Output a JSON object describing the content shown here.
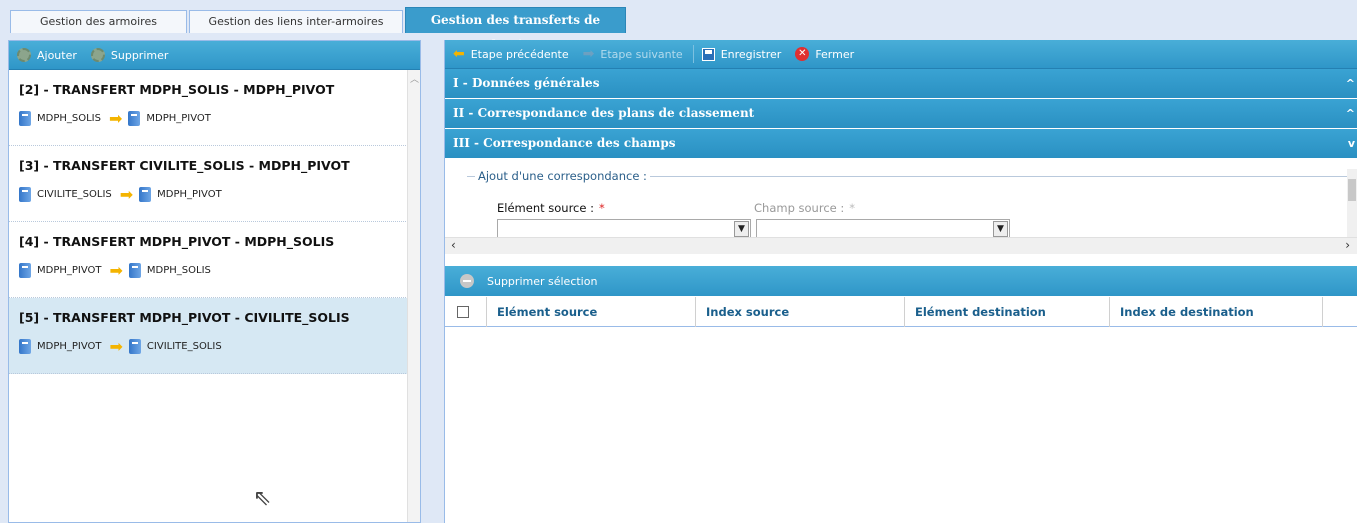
{
  "tabs": [
    {
      "label": "Gestion des armoires"
    },
    {
      "label": "Gestion des liens inter-armoires"
    },
    {
      "label": "Gestion des transferts de dossiers",
      "active": true
    }
  ],
  "left_toolbar": {
    "add_label": "Ajouter",
    "delete_label": "Supprimer"
  },
  "transfers": [
    {
      "title": "[2] - TRANSFERT MDPH_SOLIS - MDPH_PIVOT",
      "source": "MDPH_SOLIS",
      "target": "MDPH_PIVOT"
    },
    {
      "title": "[3] - TRANSFERT CIVILITE_SOLIS - MDPH_PIVOT",
      "source": "CIVILITE_SOLIS",
      "target": "MDPH_PIVOT"
    },
    {
      "title": "[4] - TRANSFERT MDPH_PIVOT - MDPH_SOLIS",
      "source": "MDPH_PIVOT",
      "target": "MDPH_SOLIS"
    },
    {
      "title": "[5] - TRANSFERT MDPH_PIVOT - CIVILITE_SOLIS",
      "source": "MDPH_PIVOT",
      "target": "CIVILITE_SOLIS",
      "selected": true
    }
  ],
  "right_toolbar": {
    "prev_label": "Etape précédente",
    "next_label": "Etape suivante",
    "save_label": "Enregistrer",
    "close_label": "Fermer"
  },
  "sections": [
    {
      "label": "I - Données générales",
      "chevron": "^"
    },
    {
      "label": "II - Correspondance des plans de classement",
      "chevron": "^"
    },
    {
      "label": "III - Correspondance des champs",
      "chevron": "v"
    }
  ],
  "form": {
    "legend": "Ajout d'une correspondance :",
    "source_element_label": "Elément source :",
    "source_field_label": "Champ source :",
    "required_mark": "*"
  },
  "grid": {
    "delete_selection_label": "Supprimer sélection",
    "columns": [
      "Elément source",
      "Index source",
      "Elément destination",
      "Index de destination"
    ],
    "rows": []
  }
}
